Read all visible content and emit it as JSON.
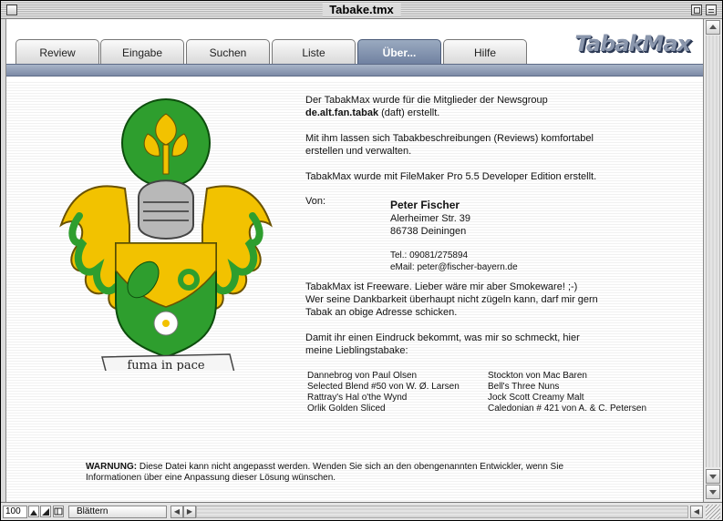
{
  "window": {
    "title": "Tabake.tmx"
  },
  "tabs": [
    {
      "label": "Review",
      "active": false
    },
    {
      "label": "Eingabe",
      "active": false
    },
    {
      "label": "Suchen",
      "active": false
    },
    {
      "label": "Liste",
      "active": false
    },
    {
      "label": "Über...",
      "active": true
    },
    {
      "label": "Hilfe",
      "active": false
    }
  ],
  "logo": {
    "text": "TabakMax"
  },
  "coat_of_arms": {
    "motto": "fuma in pace"
  },
  "about": {
    "intro_line1": "Der TabakMax wurde für die Mitglieder der Newsgroup",
    "newsgroup": "de.alt.fan.tabak",
    "intro_line2_rest": " (daft) erstellt.",
    "desc_line1": "Mit ihm lassen sich Tabakbeschreibungen (Reviews) komfortabel",
    "desc_line2": "erstellen und verwalten.",
    "made_with": "TabakMax wurde mit FileMaker Pro 5.5 Developer Edition erstellt.",
    "von_label": "Von:",
    "author_name": "Peter Fischer",
    "street": "Alerheimer Str. 39",
    "city": "86738 Deiningen",
    "phone": "Tel.: 09081/275894",
    "email": "eMail: peter@fischer-bayern.de",
    "freeware_line1": "TabakMax ist Freeware. Lieber wäre mir aber Smokeware! ;-)",
    "freeware_line2": "Wer seine Dankbarkeit überhaupt nicht zügeln kann, darf mir gern",
    "freeware_line3": "Tabak an obige Adresse schicken.",
    "favorites_line1": "Damit ihr einen Eindruck bekommt, was mir so schmeckt, hier",
    "favorites_line2": "meine Lieblingstabake:"
  },
  "favorites_left": [
    "Dannebrog von Paul Olsen",
    "Selected Blend #50 von W. Ø. Larsen",
    "Rattray's Hal o'the Wynd",
    "Orlik Golden Sliced"
  ],
  "favorites_right": [
    "Stockton von Mac Baren",
    "Bell's Three Nuns",
    "Jock Scott Creamy Malt",
    "Caledonian # 421 von A. & C. Petersen"
  ],
  "warning": {
    "label": "WARNUNG:",
    "text_line1": " Diese Datei kann nicht angepasst werden. Wenden Sie sich an den obengenannten Entwickler, wenn Sie",
    "text_line2": "Informationen über eine Anpassung dieser Lösung wünschen."
  },
  "statusbar": {
    "zoom": "100",
    "mode": "Blättern"
  },
  "colors": {
    "tab_active": "#7b8bab",
    "shield_green": "#2e9e2e",
    "shield_yellow": "#f2c200"
  }
}
